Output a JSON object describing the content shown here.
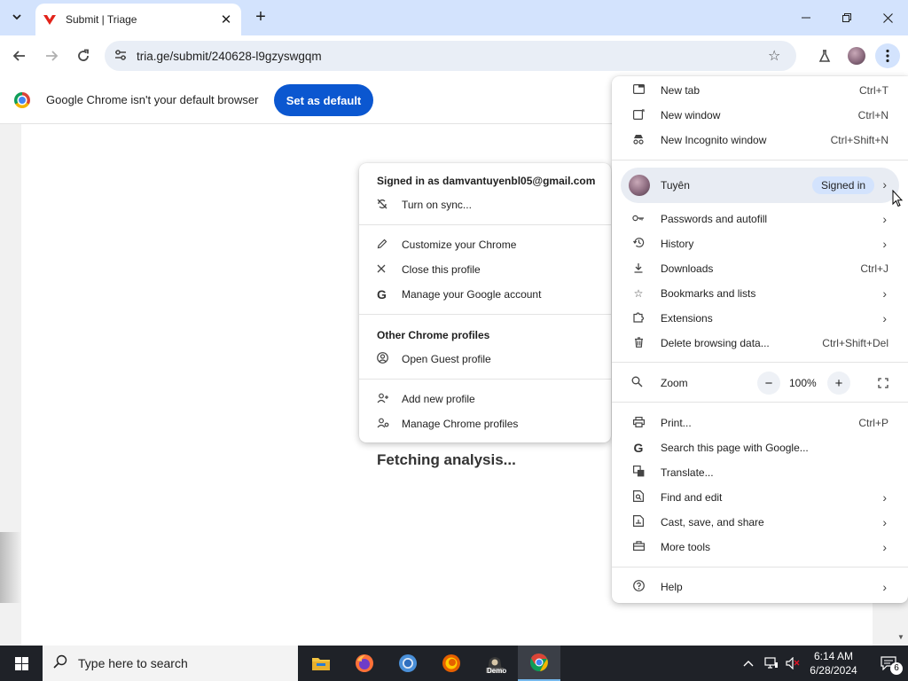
{
  "browser": {
    "tab_title": "Submit | Triage",
    "url": "tria.ge/submit/240628-l9gzyswgqm",
    "infobar_message": "Google Chrome isn't your default browser",
    "infobar_button": "Set as default"
  },
  "page": {
    "status_text": "Fetching analysis..."
  },
  "profile_menu": {
    "signed_in_as": "Signed in as damvantuyenbl05@gmail.com",
    "items": [
      {
        "label": "Turn on sync...",
        "icon": "sync-off-icon"
      },
      {
        "label": "Customize your Chrome",
        "icon": "pencil-icon"
      },
      {
        "label": "Close this profile",
        "icon": "close-icon"
      },
      {
        "label": "Manage your Google account",
        "icon": "google-g-icon"
      }
    ],
    "other_profiles_heading": "Other Chrome profiles",
    "other_items": [
      {
        "label": "Open Guest profile",
        "icon": "guest-icon"
      },
      {
        "label": "Add new profile",
        "icon": "add-person-icon"
      },
      {
        "label": "Manage Chrome profiles",
        "icon": "manage-people-icon"
      }
    ]
  },
  "main_menu": {
    "items_top": [
      {
        "label": "New tab",
        "shortcut": "Ctrl+T"
      },
      {
        "label": "New window",
        "shortcut": "Ctrl+N"
      },
      {
        "label": "New Incognito window",
        "shortcut": "Ctrl+Shift+N"
      }
    ],
    "profile": {
      "name": "Tuyên",
      "badge": "Signed in"
    },
    "items_mid": [
      {
        "label": "Passwords and autofill",
        "shortcut": ""
      },
      {
        "label": "History",
        "shortcut": ""
      },
      {
        "label": "Downloads",
        "shortcut": "Ctrl+J"
      },
      {
        "label": "Bookmarks and lists",
        "shortcut": ""
      },
      {
        "label": "Extensions",
        "shortcut": ""
      },
      {
        "label": "Delete browsing data...",
        "shortcut": "Ctrl+Shift+Del"
      }
    ],
    "zoom": {
      "label": "Zoom",
      "value": "100%",
      "minus": "−",
      "plus": "+"
    },
    "items_bottom": [
      {
        "label": "Print...",
        "shortcut": "Ctrl+P"
      },
      {
        "label": "Search this page with Google...",
        "shortcut": ""
      },
      {
        "label": "Translate...",
        "shortcut": ""
      },
      {
        "label": "Find and edit",
        "shortcut": ""
      },
      {
        "label": "Cast, save, and share",
        "shortcut": ""
      },
      {
        "label": "More tools",
        "shortcut": ""
      }
    ],
    "help": {
      "label": "Help"
    }
  },
  "taskbar": {
    "search_placeholder": "Type here to search",
    "time": "6:14 AM",
    "date": "6/28/2024",
    "notification_count": "6",
    "demo_label": "Demo"
  }
}
